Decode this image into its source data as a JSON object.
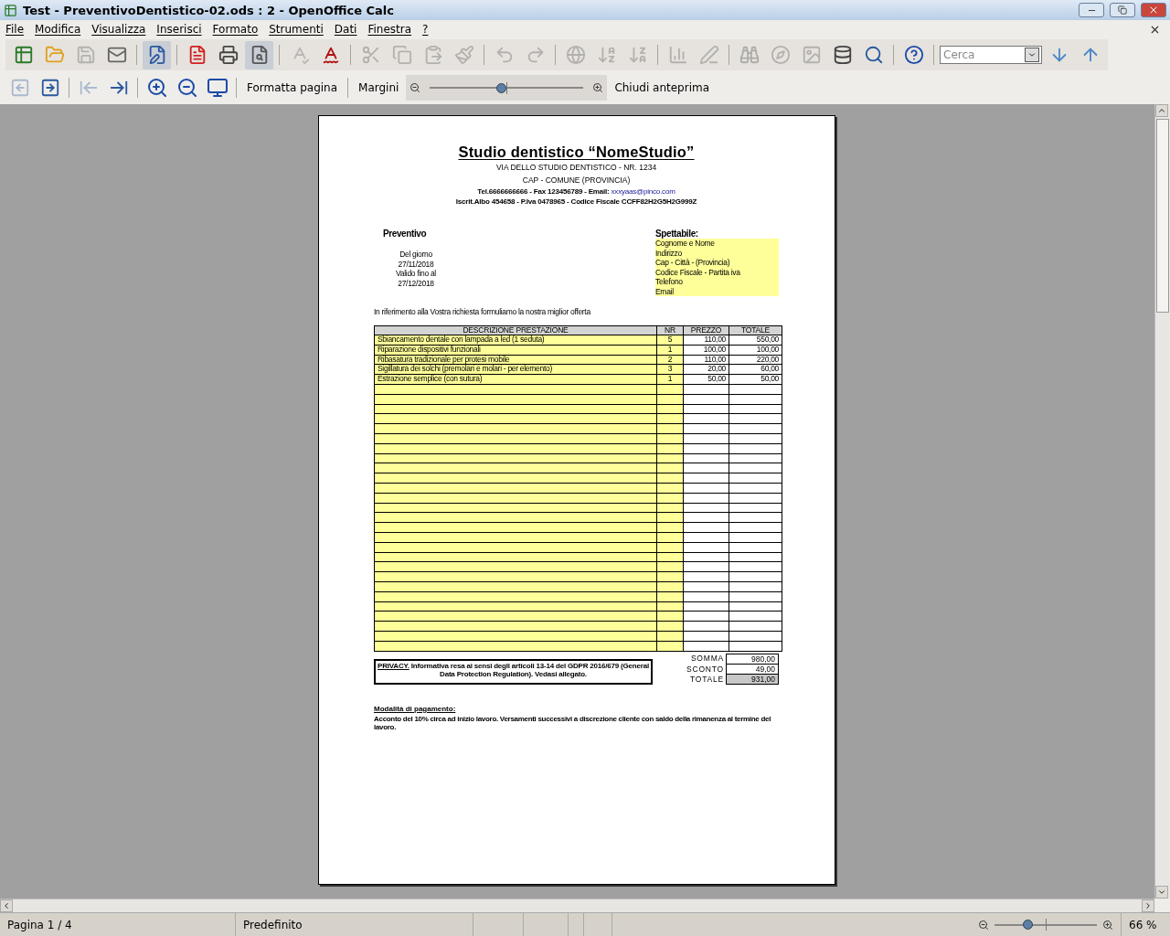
{
  "window": {
    "title": "Test - PreventivoDentistico-02.ods : 2 - OpenOffice Calc"
  },
  "menu": [
    "File",
    "Modifica",
    "Visualizza",
    "Inserisci",
    "Formato",
    "Strumenti",
    "Dati",
    "Finestra",
    "?"
  ],
  "toolbar": [
    {
      "disabled": false
    },
    {
      "disabled": false
    },
    {
      "disabled": true
    },
    {
      "disabled": false
    },
    {
      "disabled": false,
      "selected": true
    },
    {
      "disabled": false
    },
    {
      "disabled": false
    },
    {
      "disabled": false,
      "selected": true
    },
    {
      "disabled": true
    },
    {
      "disabled": false
    },
    {
      "disabled": true
    },
    {
      "disabled": true
    },
    {
      "disabled": true
    },
    {
      "disabled": true
    },
    {
      "disabled": true
    },
    {
      "disabled": true
    },
    {
      "disabled": true
    },
    {
      "disabled": true
    },
    {
      "disabled": true
    },
    {
      "disabled": true
    },
    {
      "disabled": true
    },
    {
      "disabled": true
    },
    {
      "disabled": true
    },
    {
      "disabled": true
    },
    {
      "disabled": false
    },
    {
      "disabled": false
    },
    {
      "disabled": false
    }
  ],
  "search": {
    "placeholder": "Cerca"
  },
  "preview_toolbar": {
    "nav": [
      {
        "disabled": true
      },
      {
        "disabled": false
      },
      {
        "disabled": true
      },
      {
        "disabled": false
      }
    ],
    "format_page": "Formatta pagina",
    "margins": "Margini",
    "zoom": {
      "level": 0.46
    },
    "close_preview": "Chiudi anteprima"
  },
  "document": {
    "studio_name": "Studio dentistico “NomeStudio”",
    "address": "VIA DELLO STUDIO DENTISTICO - NR. 1234",
    "city": "CAP - COMUNE (PROVINCIA)",
    "contacts": "Tel.6666666666 - Fax 123456789 - Email: ",
    "email": "xxxyaas@pinco.com",
    "registry": "Iscrit.Albo 454658 - P.Iva 0478965 - Codice Fiscale CCFF82H2G5H2G999Z",
    "quote_title": "Preventivo",
    "quote_dates": [
      "Del giorno",
      "27/11/2018",
      "Valido fino al",
      "27/12/2018"
    ],
    "recipient_title": "Spettabile:",
    "recipient_lines": [
      "Cognome e Nome",
      "Indirizzo",
      "Cap - Città - (Provincia)",
      "Codice Fiscale - Partita iva",
      "Telefono",
      "Email"
    ],
    "intro": "In riferimento alla Vostra richiesta formuliamo la nostra miglior offerta",
    "table": {
      "columns": [
        "DESCRIZIONE PRESTAZIONE",
        "NR",
        "PREZZO",
        "TOTALE"
      ],
      "rows": [
        [
          "Sbiancamento dentale con lampada a led (1 seduta)",
          "5",
          "110,00",
          "550,00"
        ],
        [
          "Riparazione dispositivi funzionali",
          "1",
          "100,00",
          "100,00"
        ],
        [
          "Ribasatura tradizionale per protesi mobile",
          "2",
          "110,00",
          "220,00"
        ],
        [
          "Sigillatura dei solchi (premolari e molari - per elemento)",
          "3",
          "20,00",
          "60,00"
        ],
        [
          "Estrazione semplice (con sutura)",
          "1",
          "50,00",
          "50,00"
        ]
      ]
    },
    "totals": [
      {
        "label": "SOMMA",
        "value": "980,00",
        "highlight": false
      },
      {
        "label": "SCONTO",
        "value": "49,00",
        "highlight": false
      },
      {
        "label": "TOTALE",
        "value": "931,00",
        "highlight": true
      }
    ],
    "privacy_link": "PRIVACY.",
    "privacy": " Informativa resa ai sensi degli articoli 13-14 del GDPR 2016/679 (General Data Protection Regulation). Vedasi allegato.",
    "payment_title": "Modalità di pagamento:",
    "payment": "Acconto del 10% circa ad inizio lavoro. Versamenti successivi a discrezione cliente con saldo della rimanenza al termine del lavoro."
  },
  "status_bar": {
    "page": "Pagina 1 / 4",
    "style": "Predefinito",
    "zoom": {
      "level": 0.32
    },
    "zoom_text": "66 %"
  }
}
